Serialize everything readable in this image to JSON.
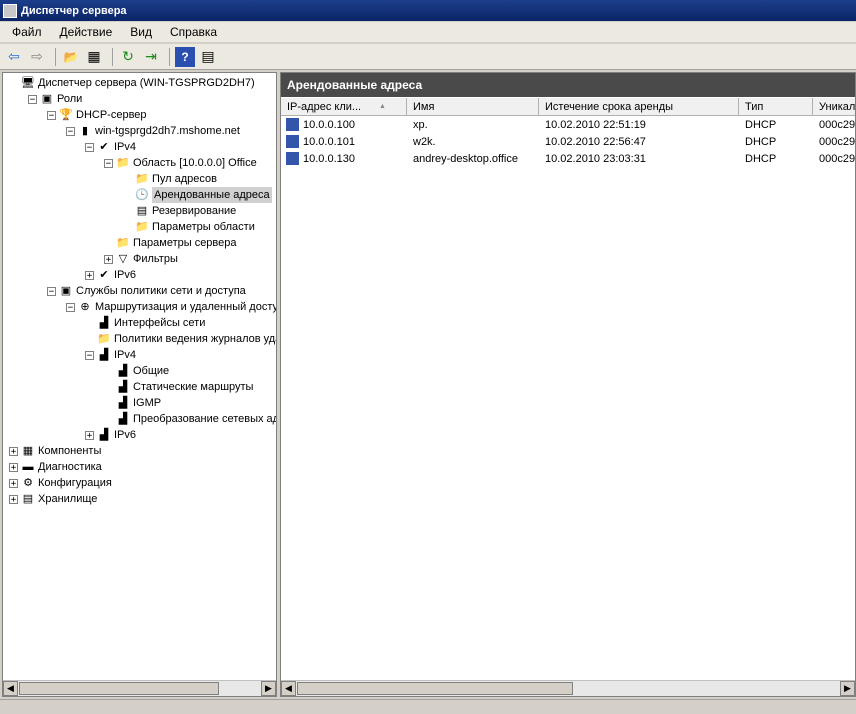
{
  "window": {
    "title": "Диспетчер сервера"
  },
  "menu": [
    "Файл",
    "Действие",
    "Вид",
    "Справка"
  ],
  "toolbar": {
    "icons": [
      "back-arrow-icon",
      "forward-arrow-icon",
      "up-folder-icon",
      "show-hide-tree-icon",
      "refresh-icon",
      "export-list-icon",
      "help-icon",
      "show-hide-action-pane-icon"
    ],
    "glyphs": [
      "⇦",
      "⇨",
      "📂",
      "▦",
      "↻",
      "⇥",
      "?",
      "▤"
    ]
  },
  "tree": [
    {
      "label": "Диспетчер сервера (WIN-TGSPRGD2DH7)",
      "level": 0,
      "expander": "",
      "icon": "server-manager-icon",
      "glyph": "🖥"
    },
    {
      "label": "Роли",
      "level": 1,
      "expander": "−",
      "icon": "roles-icon",
      "glyph": "▣"
    },
    {
      "label": "DHCP-сервер",
      "level": 2,
      "expander": "−",
      "icon": "dhcp-server-icon",
      "glyph": "🏆"
    },
    {
      "label": "win-tgsprgd2dh7.mshome.net",
      "level": 3,
      "expander": "−",
      "icon": "server-icon",
      "glyph": "▮"
    },
    {
      "label": "IPv4",
      "level": 4,
      "expander": "−",
      "icon": "ipv4-ok-icon",
      "glyph": "✔"
    },
    {
      "label": "Область [10.0.0.0] Office",
      "level": 5,
      "expander": "−",
      "icon": "scope-folder-icon",
      "glyph": "📁"
    },
    {
      "label": "Пул адресов",
      "level": 6,
      "expander": "",
      "icon": "address-pool-icon",
      "glyph": "📁"
    },
    {
      "label": "Арендованные адреса",
      "level": 6,
      "expander": "",
      "icon": "leases-icon",
      "glyph": "🕒",
      "selected": true
    },
    {
      "label": "Резервирование",
      "level": 6,
      "expander": "",
      "icon": "reservations-icon",
      "glyph": "▤"
    },
    {
      "label": "Параметры области",
      "level": 6,
      "expander": "",
      "icon": "scope-options-icon",
      "glyph": "📁"
    },
    {
      "label": "Параметры сервера",
      "level": 5,
      "expander": "",
      "icon": "server-options-icon",
      "glyph": "📁"
    },
    {
      "label": "Фильтры",
      "level": 5,
      "expander": "+",
      "icon": "filters-icon",
      "glyph": "▽"
    },
    {
      "label": "IPv6",
      "level": 4,
      "expander": "+",
      "icon": "ipv6-ok-icon",
      "glyph": "✔"
    },
    {
      "label": "Службы политики сети и доступа",
      "level": 2,
      "expander": "−",
      "icon": "npas-icon",
      "glyph": "▣"
    },
    {
      "label": "Маршрутизация и удаленный доступ",
      "level": 3,
      "expander": "−",
      "icon": "routing-icon",
      "glyph": "⊕"
    },
    {
      "label": "Интерфейсы сети",
      "level": 4,
      "expander": "",
      "icon": "network-interfaces-icon",
      "glyph": "▟"
    },
    {
      "label": "Политики ведения журналов уда",
      "level": 4,
      "expander": "",
      "icon": "logging-folder-icon",
      "glyph": "📁"
    },
    {
      "label": "IPv4",
      "level": 4,
      "expander": "−",
      "icon": "routing-ipv4-icon",
      "glyph": "▟"
    },
    {
      "label": "Общие",
      "level": 5,
      "expander": "",
      "icon": "general-icon",
      "glyph": "▟"
    },
    {
      "label": "Статические маршруты",
      "level": 5,
      "expander": "",
      "icon": "static-routes-icon",
      "glyph": "▟"
    },
    {
      "label": "IGMP",
      "level": 5,
      "expander": "",
      "icon": "igmp-icon",
      "glyph": "▟"
    },
    {
      "label": "Преобразование сетевых адр",
      "level": 5,
      "expander": "",
      "icon": "nat-icon",
      "glyph": "▟"
    },
    {
      "label": "IPv6",
      "level": 4,
      "expander": "+",
      "icon": "routing-ipv6-icon",
      "glyph": "▟"
    },
    {
      "label": "Компоненты",
      "level": 0,
      "expander": "+",
      "icon": "features-icon",
      "glyph": "▦"
    },
    {
      "label": "Диагностика",
      "level": 0,
      "expander": "+",
      "icon": "diagnostics-icon",
      "glyph": "▬"
    },
    {
      "label": "Конфигурация",
      "level": 0,
      "expander": "+",
      "icon": "configuration-icon",
      "glyph": "⚙"
    },
    {
      "label": "Хранилище",
      "level": 0,
      "expander": "+",
      "icon": "storage-icon",
      "glyph": "▤"
    }
  ],
  "pane": {
    "title": "Арендованные адреса",
    "columns": [
      "IP-адрес кли...",
      "Имя",
      "Истечение срока аренды",
      "Тип",
      "Уникал"
    ],
    "sort_glyph": "▲",
    "rows": [
      {
        "ip": "10.0.0.100",
        "name": "xp.",
        "expires": "10.02.2010 22:51:19",
        "type": "DHCP",
        "uid": "000c29"
      },
      {
        "ip": "10.0.0.101",
        "name": "w2k.",
        "expires": "10.02.2010 22:56:47",
        "type": "DHCP",
        "uid": "000c29"
      },
      {
        "ip": "10.0.0.130",
        "name": "andrey-desktop.office",
        "expires": "10.02.2010 23:03:31",
        "type": "DHCP",
        "uid": "000c29"
      }
    ]
  },
  "scroll_glyphs": {
    "left": "◀",
    "right": "▶"
  },
  "colors": {
    "title_bg": "#0a2466",
    "pane_header_bg": "#4a4a4a",
    "selection": "#d0d0d0",
    "lease_icon": "#3355aa"
  }
}
